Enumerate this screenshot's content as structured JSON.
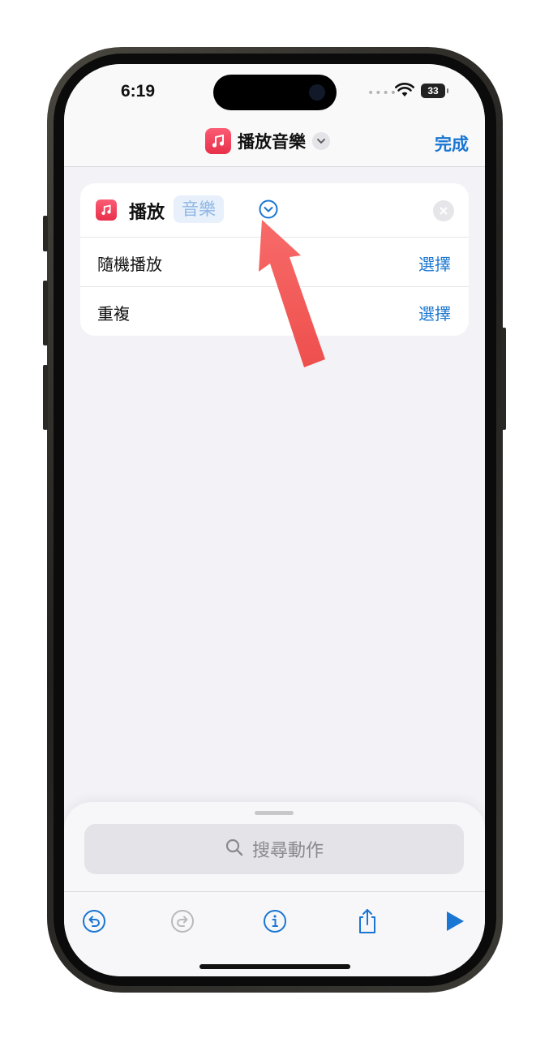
{
  "status_bar": {
    "time": "6:19",
    "battery": "33"
  },
  "nav": {
    "title": "播放音樂",
    "done_label": "完成"
  },
  "action_card": {
    "verb": "播放",
    "parameter": "音樂",
    "rows": [
      {
        "label": "隨機播放",
        "action": "選擇"
      },
      {
        "label": "重複",
        "action": "選擇"
      }
    ]
  },
  "bottom_sheet": {
    "search_placeholder": "搜尋動作"
  },
  "toolbar": {
    "icons": [
      "undo-icon",
      "redo-icon",
      "info-icon",
      "share-icon",
      "play-icon"
    ]
  },
  "colors": {
    "accent": "#1976d2",
    "music_icon": "#f43f5e",
    "annotation_arrow": "#f25a58"
  }
}
